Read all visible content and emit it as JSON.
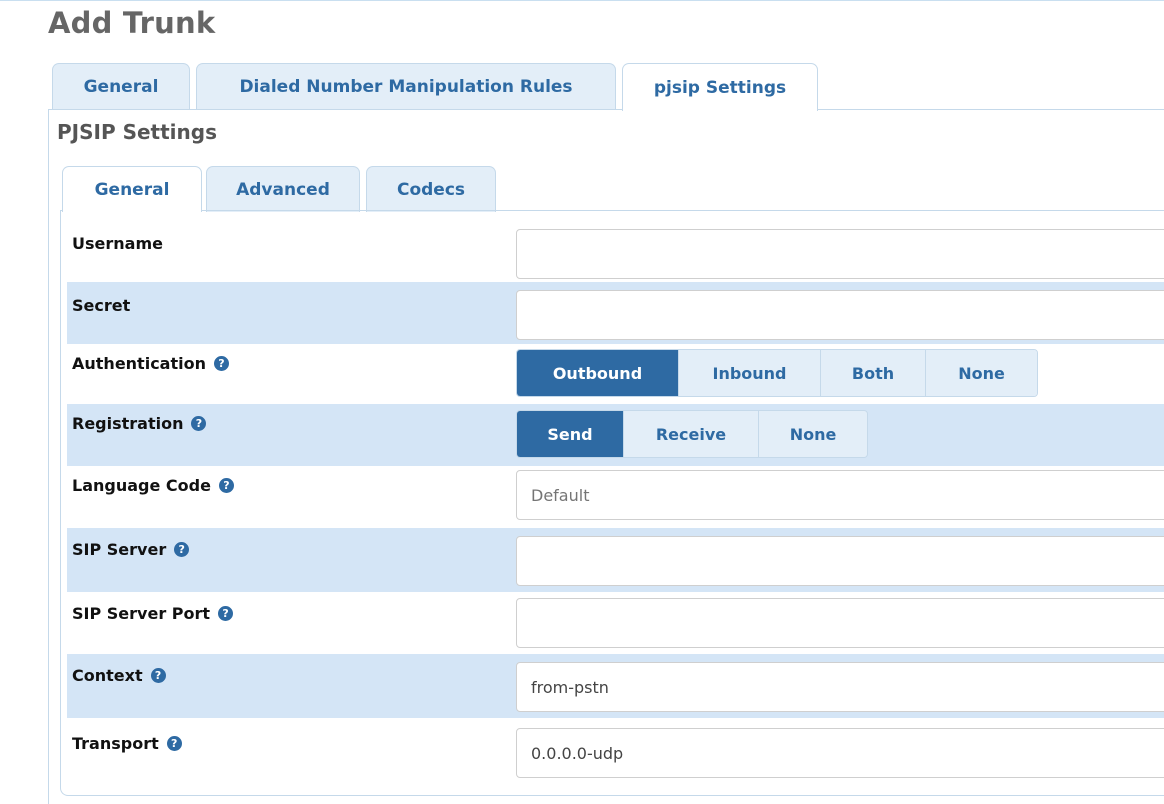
{
  "page": {
    "title": "Add Trunk"
  },
  "outer_tabs": [
    {
      "label": "General",
      "active": false
    },
    {
      "label": "Dialed Number Manipulation Rules",
      "active": false
    },
    {
      "label": "pjsip Settings",
      "active": true
    }
  ],
  "section": {
    "title": "PJSIP Settings"
  },
  "inner_tabs": [
    {
      "label": "General",
      "active": true
    },
    {
      "label": "Advanced",
      "active": false
    },
    {
      "label": "Codecs",
      "active": false
    }
  ],
  "help_glyph": "?",
  "form": {
    "username": {
      "label": "Username",
      "value": ""
    },
    "secret": {
      "label": "Secret",
      "value": ""
    },
    "authentication": {
      "label": "Authentication",
      "options": [
        "Outbound",
        "Inbound",
        "Both",
        "None"
      ],
      "selected": "Outbound"
    },
    "registration": {
      "label": "Registration",
      "options": [
        "Send",
        "Receive",
        "None"
      ],
      "selected": "Send"
    },
    "language_code": {
      "label": "Language Code",
      "value": "",
      "placeholder": "Default"
    },
    "sip_server": {
      "label": "SIP Server",
      "value": ""
    },
    "sip_server_port": {
      "label": "SIP Server Port",
      "value": ""
    },
    "context": {
      "label": "Context",
      "value": "from-pstn"
    },
    "transport": {
      "label": "Transport",
      "value": "0.0.0.0-udp"
    }
  },
  "colors": {
    "accent": "#2e6aa3",
    "tab_bg": "#e3eef8",
    "row_alt_bg": "#d4e5f6",
    "title_gray": "#666666"
  }
}
